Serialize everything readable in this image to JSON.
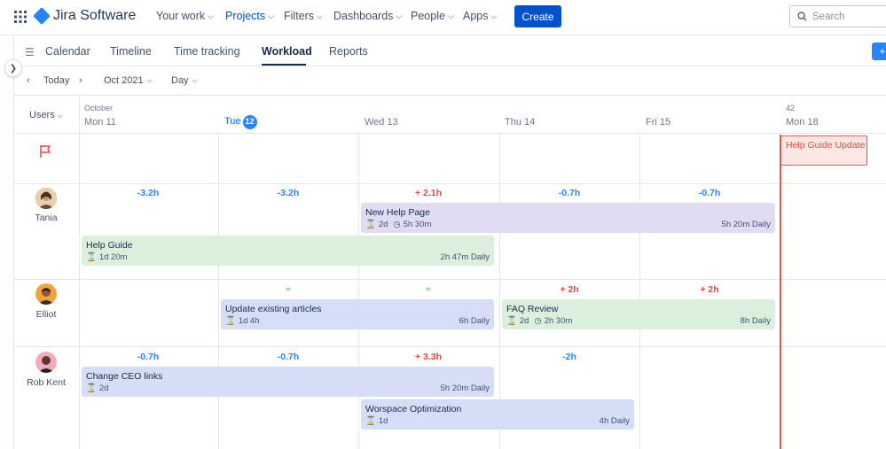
{
  "topnav": {
    "logo": "Jira Software",
    "items": [
      {
        "label": "Your work"
      },
      {
        "label": "Projects"
      },
      {
        "label": "Filters"
      },
      {
        "label": "Dashboards"
      },
      {
        "label": "People"
      },
      {
        "label": "Apps"
      }
    ],
    "active_item": "Projects",
    "create_label": "Create",
    "search_placeholder": "Search"
  },
  "subnav": {
    "tabs": [
      {
        "label": "Calendar"
      },
      {
        "label": "Timeline"
      },
      {
        "label": "Time tracking"
      },
      {
        "label": "Workload"
      },
      {
        "label": "Reports"
      }
    ],
    "active_tab": "Workload",
    "add_label": "+"
  },
  "toolbar": {
    "today_label": "Today",
    "month_label": "Oct 2021",
    "view_label": "Day"
  },
  "grid": {
    "users_label": "Users",
    "month_caption": "October",
    "week_caption": "42",
    "days": [
      {
        "label": "Mon 11"
      },
      {
        "label": "Tue",
        "badge": "12"
      },
      {
        "label": "Wed 13"
      },
      {
        "label": "Thu 14"
      },
      {
        "label": "Fri 15"
      },
      {
        "label": "Mon 18"
      }
    ]
  },
  "milestone": {
    "title": "Help Guide Update"
  },
  "users": [
    {
      "name": "Tania",
      "capacity": [
        "-3.2h",
        "-3.2h",
        "+ 2.1h",
        "-0.7h",
        "-0.7h"
      ],
      "tasks": [
        {
          "title": "New Help Page",
          "duration": "2d",
          "logged": "5h 30m",
          "rate": "5h 20m Daily"
        },
        {
          "title": "Help Guide",
          "duration": "1d 20m",
          "rate": "2h 47m Daily"
        }
      ]
    },
    {
      "name": "Elliot",
      "capacity": [
        "",
        "=",
        "=",
        "+ 2h",
        "+ 2h"
      ],
      "tasks": [
        {
          "title": "Update existing articles",
          "duration": "1d 4h",
          "rate": "6h Daily"
        },
        {
          "title": "FAQ Review",
          "duration": "2d",
          "logged": "2h 30m",
          "rate": "8h Daily"
        }
      ]
    },
    {
      "name": "Rob Kent",
      "capacity": [
        "-0.7h",
        "-0.7h",
        "+ 3.3h",
        "-2h",
        ""
      ],
      "tasks": [
        {
          "title": "Change CEO links",
          "duration": "2d",
          "rate": "5h 20m Daily"
        },
        {
          "title": "Worspace Optimization",
          "duration": "1d",
          "rate": "4h Daily"
        }
      ]
    }
  ],
  "colors": {
    "brand": "#0052cc",
    "accent": "#2684ff",
    "today_line": "#e5564a",
    "task_purple": "#e0dcf4",
    "task_green": "#dcefdc",
    "task_blue": "#d6def7"
  },
  "icons": [
    "apps-grid-icon",
    "jira-logo-icon",
    "chevron-down-icon",
    "search-icon",
    "menu-icon",
    "chevron-left-icon",
    "chevron-right-icon",
    "flag-icon",
    "hourglass-icon",
    "clock-icon"
  ]
}
